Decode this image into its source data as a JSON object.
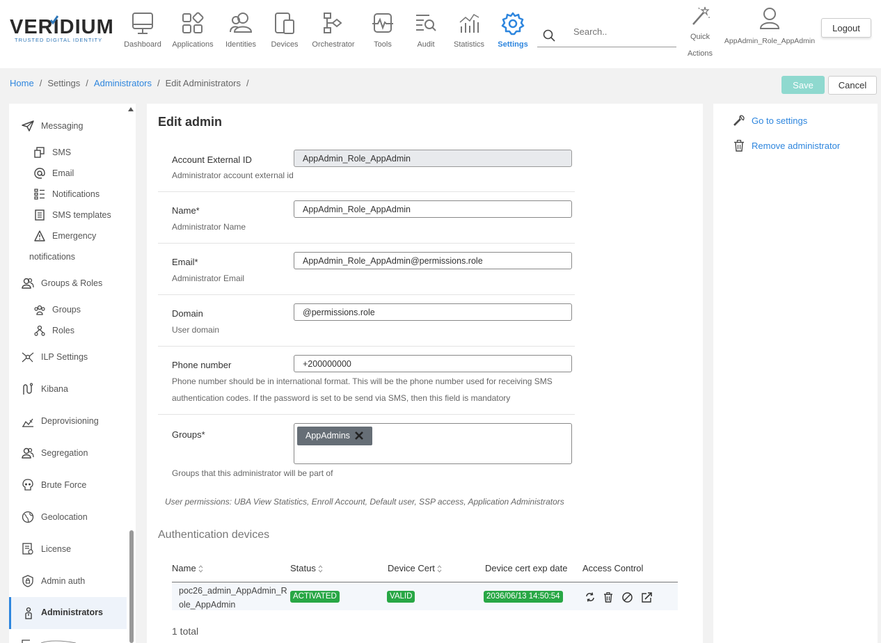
{
  "brand": {
    "name": "VERIDIUM",
    "tagline": "TRUSTED DIGITAL IDENTITY"
  },
  "nav": {
    "dashboard": "Dashboard",
    "applications": "Applications",
    "identities": "Identities",
    "devices": "Devices",
    "orchestrator": "Orchestrator",
    "tools": "Tools",
    "audit": "Audit",
    "statistics": "Statistics",
    "settings": "Settings",
    "active": "Settings"
  },
  "search": {
    "placeholder": "Search.."
  },
  "quick_actions": {
    "line1": "Quick",
    "line2": "Actions"
  },
  "user": {
    "name": "AppAdmin_Role_AppAdmin"
  },
  "logout_label": "Logout",
  "breadcrumb": {
    "home": "Home",
    "settings": "Settings",
    "administrators": "Administrators",
    "edit": "Edit Administrators",
    "sep": "/"
  },
  "actions": {
    "save": "Save",
    "cancel": "Cancel"
  },
  "sidebar": {
    "messaging": "Messaging",
    "sms": "SMS",
    "email": "Email",
    "notifications": "Notifications",
    "sms_templates": "SMS templates",
    "emergency": "Emergency",
    "emergency_cont": "notifications",
    "groups_roles": "Groups & Roles",
    "groups": "Groups",
    "roles": "Roles",
    "ilp": "ILP Settings",
    "kibana": "Kibana",
    "deprovisioning": "Deprovisioning",
    "segregation": "Segregation",
    "brute_force": "Brute Force",
    "geolocation": "Geolocation",
    "license": "License",
    "admin_auth": "Admin auth",
    "administrators": "Administrators"
  },
  "form": {
    "title": "Edit admin",
    "external_id": {
      "label": "Account External ID",
      "desc": "Administrator account external id",
      "value": "AppAdmin_Role_AppAdmin"
    },
    "name": {
      "label": "Name*",
      "desc": "Administrator Name",
      "value": "AppAdmin_Role_AppAdmin"
    },
    "email": {
      "label": "Email*",
      "desc": "Administrator Email",
      "value": "AppAdmin_Role_AppAdmin@permissions.role"
    },
    "domain": {
      "label": "Domain",
      "desc": "User domain",
      "value": "@permissions.role"
    },
    "phone": {
      "label": "Phone number",
      "desc1": "Phone number should be in international format. This will be the phone number used for receiving SMS",
      "desc2": "authentication codes. If the password is set to be send via SMS, then this field is mandatory",
      "value": "+200000000"
    },
    "groups": {
      "label": "Groups*",
      "desc": "Groups that this administrator will be part of",
      "chips": [
        "AppAdmins"
      ]
    },
    "permissions": "User permissions: UBA View Statistics, Enroll Account, Default user, SSP access, Application Administrators"
  },
  "devices": {
    "title": "Authentication devices",
    "columns": {
      "name": "Name",
      "status": "Status",
      "cert": "Device Cert",
      "exp": "Device cert exp date",
      "access": "Access Control"
    },
    "rows": [
      {
        "name_line1": "poc26_admin_AppAdmin_R",
        "name_line2": "ole_AppAdmin",
        "status": "ACTIVATED",
        "cert": "VALID",
        "exp": "2036/06/13 14:50:54"
      }
    ],
    "total": "1 total"
  },
  "right_panel": {
    "go_settings": "Go to settings",
    "remove_admin": "Remove administrator"
  },
  "colors": {
    "accent": "#2e86de",
    "save_disabled": "#8fd9cf",
    "badge_green": "#28a745",
    "chip": "#666e76"
  }
}
